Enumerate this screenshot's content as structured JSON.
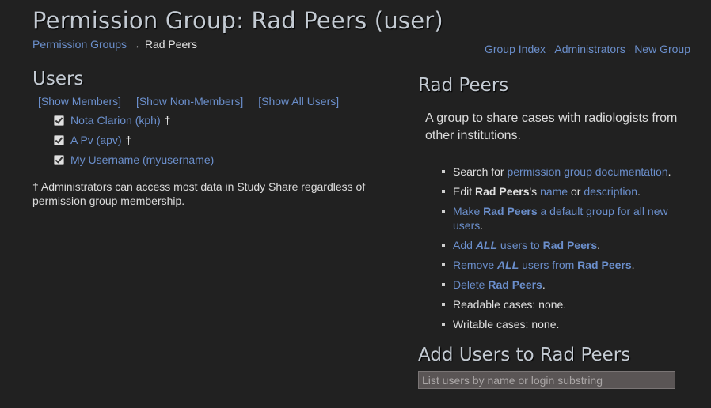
{
  "page": {
    "title": "Permission Group: Rad Peers (user)"
  },
  "breadcrumb": {
    "parent": "Permission Groups",
    "arrow": "→",
    "current": "Rad Peers"
  },
  "top_nav": {
    "items": [
      "Group Index",
      "Administrators",
      "New Group"
    ],
    "separator": "·"
  },
  "users_section": {
    "heading": "Users",
    "filters": [
      "[Show Members]",
      "[Show Non-Members]",
      "[Show All Users]"
    ],
    "users": [
      {
        "label": "Nota Clarion (kph)",
        "checked": true,
        "admin": true
      },
      {
        "label": "A Pv (apv)",
        "checked": true,
        "admin": true
      },
      {
        "label": "My Username (myusername)",
        "checked": true,
        "admin": false
      }
    ],
    "admin_marker": "†",
    "admin_note": "† Administrators can access most data in Study Share regardless of permission group membership."
  },
  "group_panel": {
    "name": "Rad Peers",
    "description": "A group to share cases with radiologists from other institutions.",
    "actions": {
      "search_prefix": "Search for ",
      "search_link": "permission group documentation",
      "edit_prefix": "Edit ",
      "edit_group": "Rad Peers",
      "edit_possessive": "'s ",
      "edit_name_link": "name",
      "edit_or": " or ",
      "edit_description_link": "description",
      "make_default_1": "Make ",
      "make_default_group": "Rad Peers",
      "make_default_2": " a default group for all new users",
      "add_all_1": "Add ",
      "add_all_emph": "ALL",
      "add_all_2": " users to ",
      "add_all_group": "Rad Peers",
      "remove_all_1": "Remove ",
      "remove_all_emph": "ALL",
      "remove_all_2": " users from ",
      "remove_all_group": "Rad Peers",
      "delete_1": "Delete ",
      "delete_group": "Rad Peers",
      "period": ".",
      "readable_cases": "Readable cases: none.",
      "writable_cases": "Writable cases: none."
    }
  },
  "add_users": {
    "heading": "Add Users to Rad Peers",
    "search_placeholder": "List users by name or login substring",
    "search_value": ""
  }
}
